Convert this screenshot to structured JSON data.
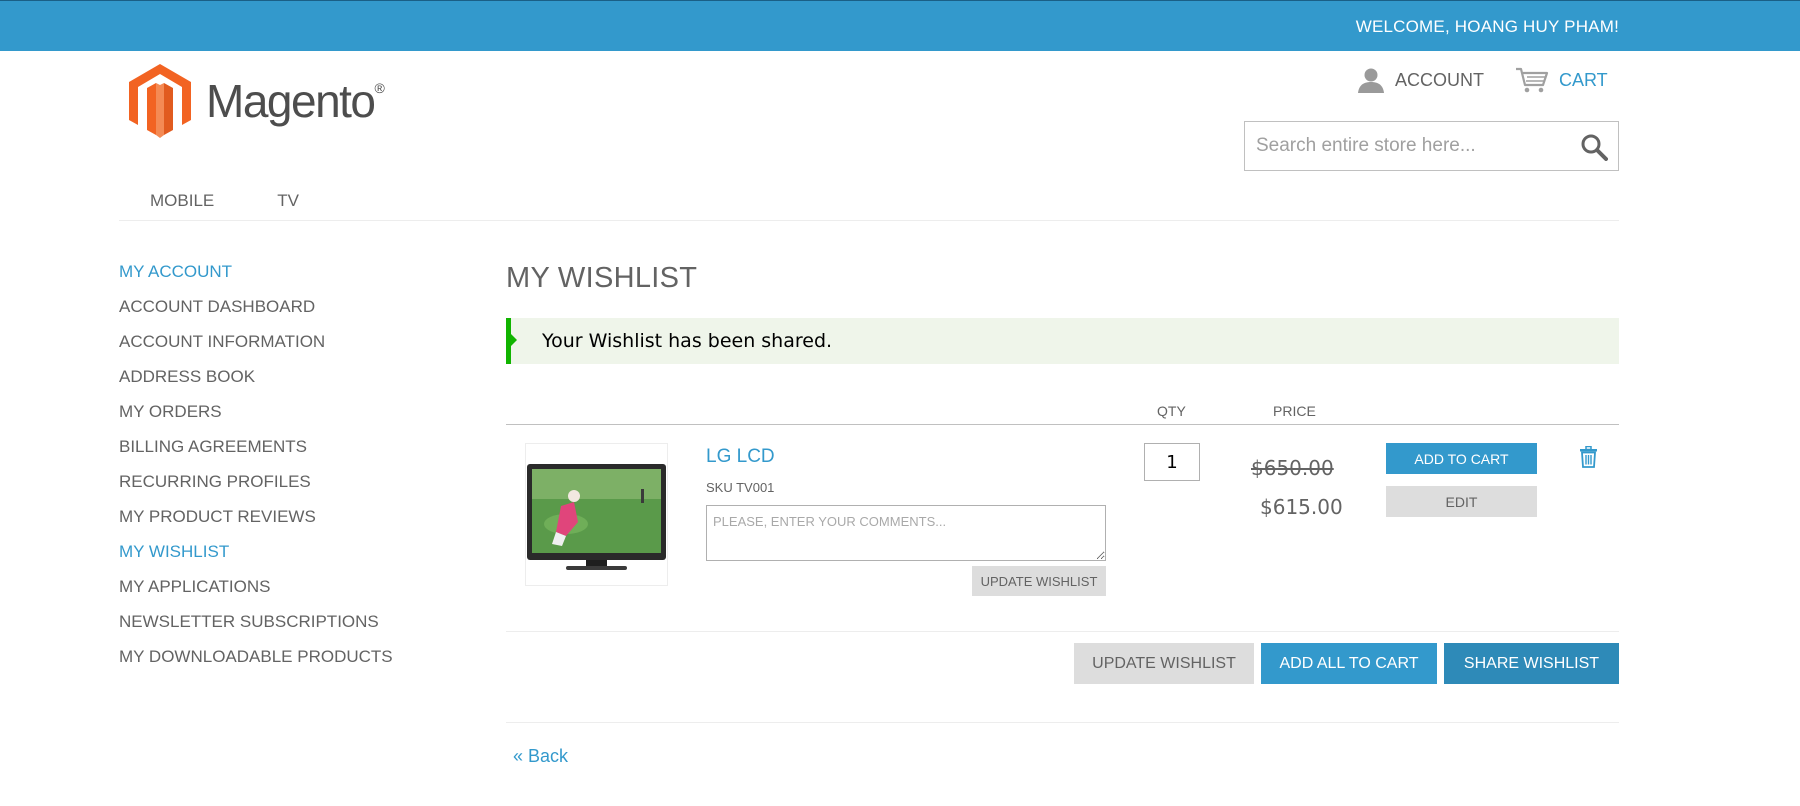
{
  "header": {
    "welcome": "WELCOME, HOANG HUY PHAM!",
    "logo_text": "Magento",
    "logo_mark": "®",
    "account_label": "ACCOUNT",
    "cart_label": "CART",
    "search_placeholder": "Search entire store here..."
  },
  "nav": {
    "items": [
      "MOBILE",
      "TV"
    ]
  },
  "sidebar": {
    "title": "MY ACCOUNT",
    "items": [
      "ACCOUNT DASHBOARD",
      "ACCOUNT INFORMATION",
      "ADDRESS BOOK",
      "MY ORDERS",
      "BILLING AGREEMENTS",
      "RECURRING PROFILES",
      "MY PRODUCT REVIEWS",
      "MY WISHLIST",
      "MY APPLICATIONS",
      "NEWSLETTER SUBSCRIPTIONS",
      "MY DOWNLOADABLE PRODUCTS"
    ],
    "active_item": "MY WISHLIST"
  },
  "main": {
    "title": "MY WISHLIST",
    "success_message": "Your Wishlist has been shared.",
    "columns": {
      "qty": "QTY",
      "price": "PRICE"
    },
    "item": {
      "name": "LG LCD",
      "sku": "SKU TV001",
      "comment_placeholder": "PLEASE, ENTER YOUR COMMENTS...",
      "update_label": "UPDATE WISHLIST",
      "qty": "1",
      "old_price": "$650.00",
      "price": "$615.00",
      "add_to_cart_label": "ADD TO CART",
      "edit_label": "EDIT",
      "remove_icon": "trash-icon"
    },
    "actions": {
      "update_wishlist": "UPDATE WISHLIST",
      "add_all_to_cart": "ADD ALL TO CART",
      "share_wishlist": "SHARE WISHLIST"
    },
    "back_label": "« Back"
  },
  "colors": {
    "brand_blue": "#3399cc",
    "success_green": "#11b400",
    "logo_orange": "#f26322"
  }
}
